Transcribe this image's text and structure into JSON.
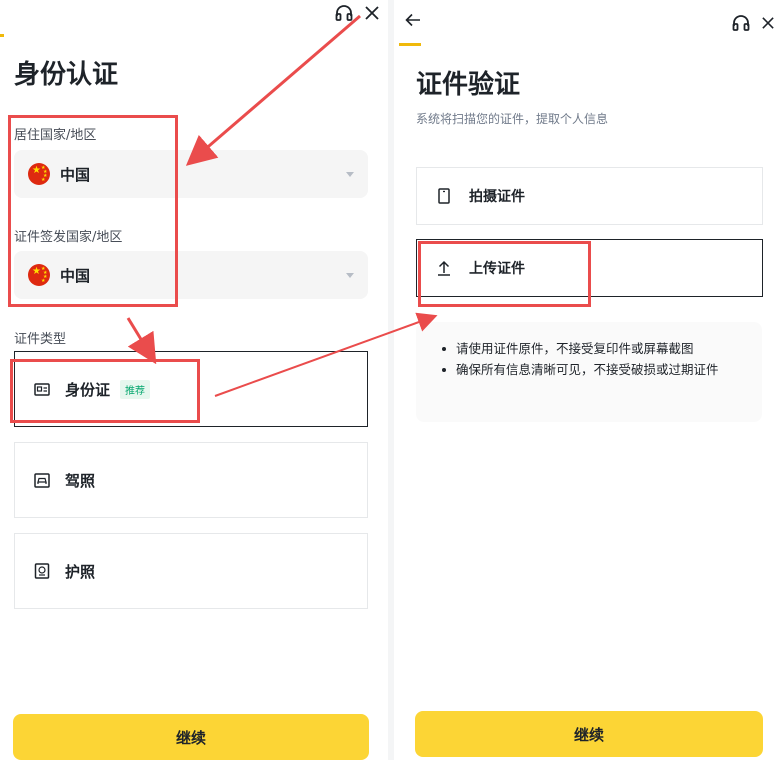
{
  "colors": {
    "accent": "#fcd535",
    "annotation": "#ea4c4c",
    "badge_green": "#03a66d"
  },
  "left": {
    "title": "身份认证",
    "residence_label": "居住国家/地区",
    "residence_value": "中国",
    "issuing_label": "证件签发国家/地区",
    "issuing_value": "中国",
    "doc_type_label": "证件类型",
    "doc_types": [
      {
        "label": "身份证",
        "badge": "推荐",
        "icon": "id-card-icon",
        "selected": true
      },
      {
        "label": "驾照",
        "icon": "driver-license-icon",
        "selected": false
      },
      {
        "label": "护照",
        "icon": "passport-icon",
        "selected": false
      }
    ],
    "continue_label": "继续"
  },
  "right": {
    "title": "证件验证",
    "subtitle": "系统将扫描您的证件，提取个人信息",
    "options": [
      {
        "label": "拍摄证件",
        "icon": "phone-camera-icon",
        "selected": false
      },
      {
        "label": "上传证件",
        "icon": "upload-icon",
        "selected": true
      }
    ],
    "tips": [
      "请使用证件原件，不接受复印件或屏幕截图",
      "确保所有信息清晰可见，不接受破损或过期证件"
    ],
    "continue_label": "继续"
  },
  "icons": {
    "support": "headset-icon",
    "close": "close-icon",
    "back": "back-arrow-icon",
    "flag": "china-flag-icon"
  }
}
